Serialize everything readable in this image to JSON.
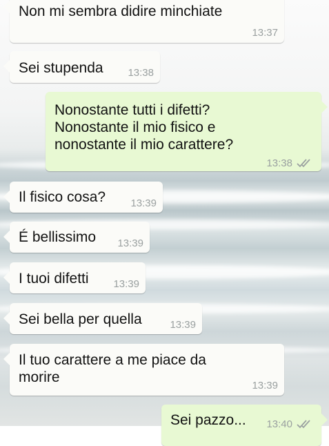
{
  "messages": [
    {
      "text": "Non mi sembra didire minchiate",
      "time": "13:37",
      "direction": "incoming"
    },
    {
      "text": "Sei stupenda",
      "time": "13:38",
      "direction": "incoming"
    },
    {
      "text": "Nonostante tutti i difetti?\nNonostante il mio fisico e\nnonostante il mio carattere?",
      "time": "13:38",
      "direction": "outgoing",
      "status": "read-double-check-icon"
    },
    {
      "text": "Il fisico cosa?",
      "time": "13:39",
      "direction": "incoming"
    },
    {
      "text": "É bellissimo",
      "time": "13:39",
      "direction": "incoming"
    },
    {
      "text": "I tuoi difetti",
      "time": "13:39",
      "direction": "incoming"
    },
    {
      "text": "Sei bella per quella",
      "time": "13:39",
      "direction": "incoming"
    },
    {
      "text": "Il tuo carattere a me piace da\nmorire",
      "time": "13:39",
      "direction": "incoming"
    },
    {
      "text": "Sei pazzo...",
      "time": "13:40",
      "direction": "outgoing",
      "status": "read-double-check-icon"
    }
  ],
  "colors": {
    "incoming_bubble": "#fbfbf8",
    "outgoing_bubble": "#e8f9d3",
    "timestamp": "#9aa0a0",
    "check_marks": "#9aa0a0"
  }
}
